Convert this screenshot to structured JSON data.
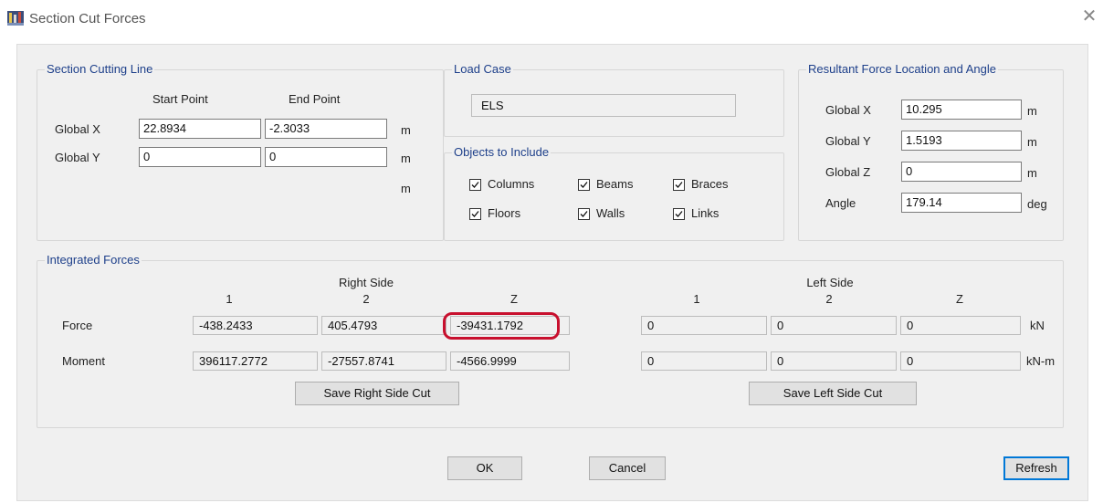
{
  "window": {
    "title": "Section Cut Forces"
  },
  "section_cutting_line": {
    "title": "Section Cutting Line",
    "start_point_label": "Start Point",
    "end_point_label": "End Point",
    "global_x_label": "Global X",
    "global_y_label": "Global Y",
    "start_x": "22.8934",
    "end_x": "-2.3033",
    "start_y": "0",
    "end_y": "0",
    "unit_x": "m",
    "unit_y": "m",
    "unit_extra": "m"
  },
  "load_case": {
    "title": "Load Case",
    "value": "ELS"
  },
  "objects_to_include": {
    "title": "Objects to Include",
    "items": [
      {
        "label": "Columns",
        "checked": true
      },
      {
        "label": "Beams",
        "checked": true
      },
      {
        "label": "Braces",
        "checked": true
      },
      {
        "label": "Floors",
        "checked": true
      },
      {
        "label": "Walls",
        "checked": true
      },
      {
        "label": "Links",
        "checked": true
      }
    ]
  },
  "resultant": {
    "title": "Resultant Force Location and Angle",
    "global_x_label": "Global X",
    "global_y_label": "Global Y",
    "global_z_label": "Global Z",
    "angle_label": "Angle",
    "x_value": "10.295",
    "y_value": "1.5193",
    "z_value": "0",
    "angle_value": "179.14",
    "unit_x": "m",
    "unit_y": "m",
    "unit_z": "m",
    "unit_angle": "deg"
  },
  "integrated_forces": {
    "title": "Integrated Forces",
    "right_side_label": "Right Side",
    "left_side_label": "Left Side",
    "col_headers": [
      "1",
      "2",
      "Z"
    ],
    "force_label": "Force",
    "moment_label": "Moment",
    "right_force": [
      "-438.2433",
      "405.4793",
      "-39431.1792"
    ],
    "right_moment": [
      "396117.2772",
      "-27557.8741",
      "-4566.9999"
    ],
    "left_force": [
      "0",
      "0",
      "0"
    ],
    "left_moment": [
      "0",
      "0",
      "0"
    ],
    "force_unit": "kN",
    "moment_unit": "kN-m",
    "save_right_label": "Save Right Side Cut",
    "save_left_label": "Save Left Side Cut"
  },
  "buttons": {
    "ok": "OK",
    "cancel": "Cancel",
    "refresh": "Refresh"
  },
  "colors": {
    "group_title": "#1d3f8a",
    "highlight_ring": "#c8102e",
    "dialog_background": "#f0f0f0",
    "default_button_border": "#0078d7"
  },
  "icons": {
    "app": "etabs-app-icon",
    "close": "close-icon",
    "checkbox": "checkmark-icon"
  }
}
